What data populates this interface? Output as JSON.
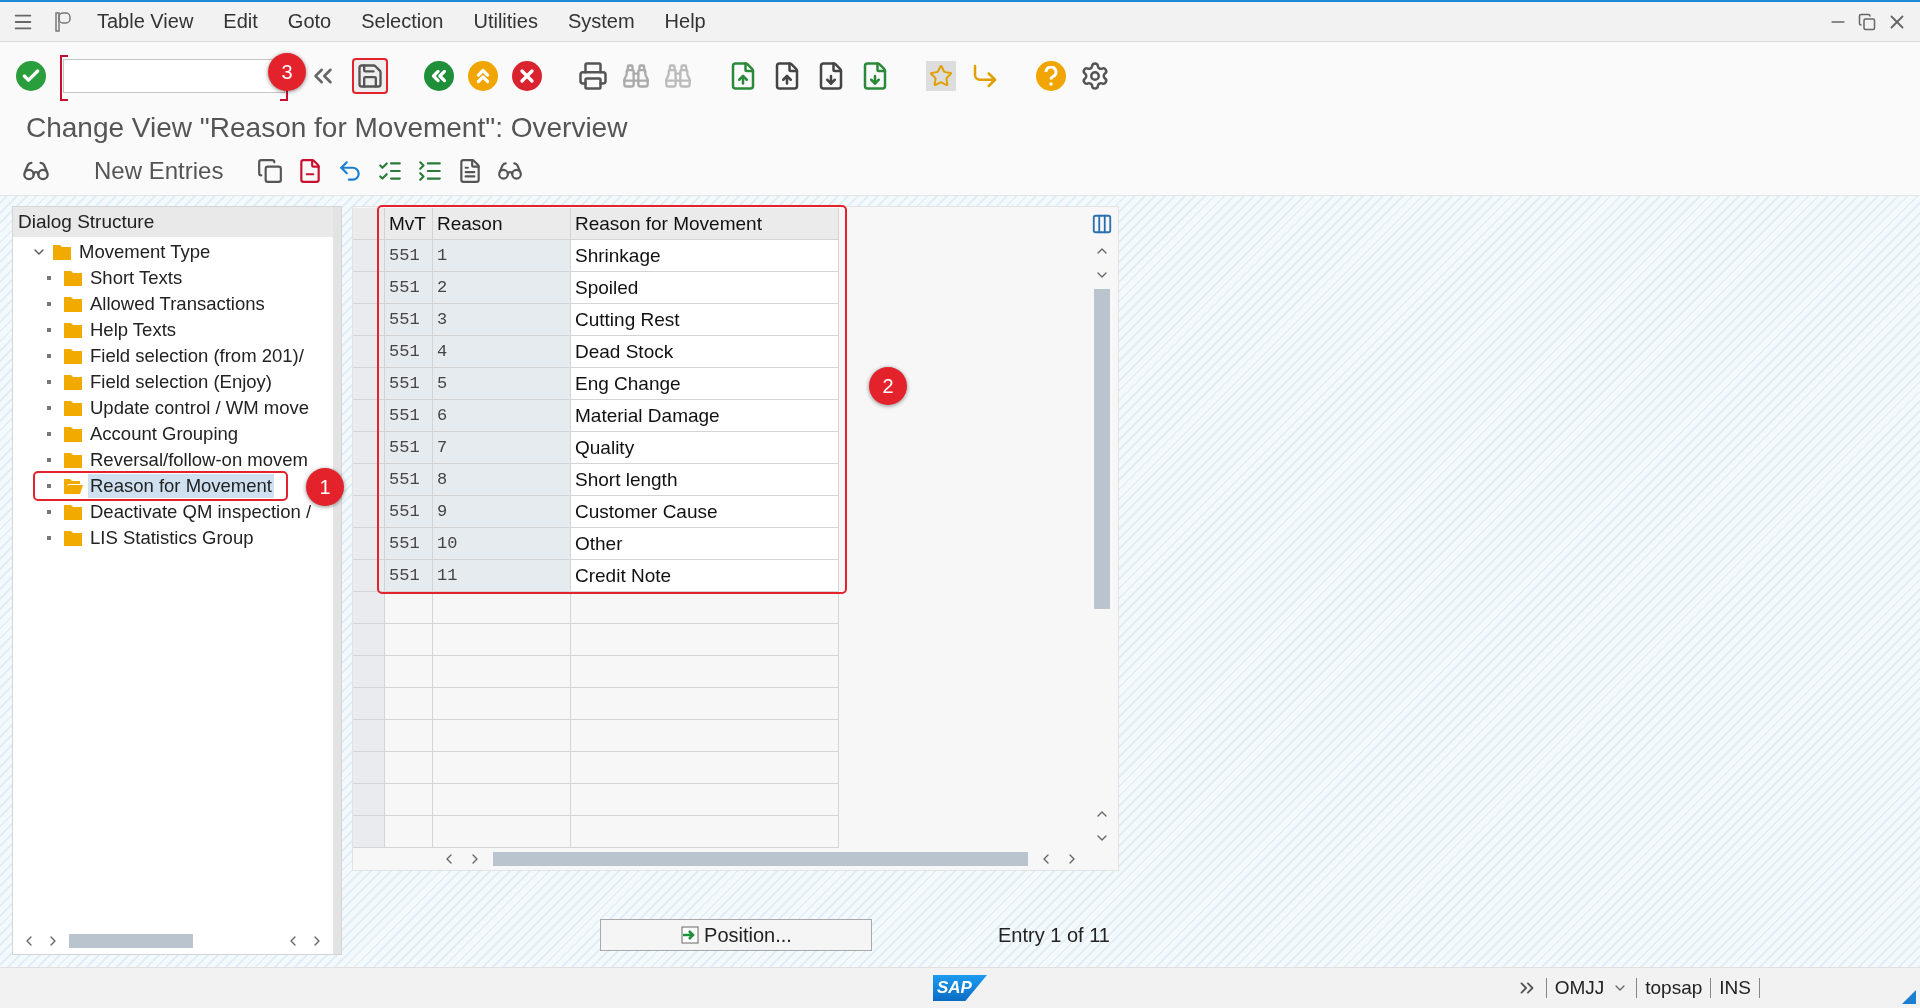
{
  "menu_bar": {
    "items": [
      "Table View",
      "Edit",
      "Goto",
      "Selection",
      "Utilities",
      "System",
      "Help"
    ]
  },
  "callouts": [
    {
      "kind": "toolbar",
      "label": "3"
    },
    {
      "kind": "tree",
      "label": "1"
    },
    {
      "kind": "table",
      "label": "2"
    }
  ],
  "title": "Change View \"Reason for Movement\": Overview",
  "app_toolbar": {
    "new_entries": "New Entries"
  },
  "dialog_structure": {
    "title": "Dialog Structure",
    "items": [
      {
        "label": "Movement Type",
        "expanded": true,
        "selected": false,
        "children": [
          {
            "label": "Short Texts",
            "selected": false
          },
          {
            "label": "Allowed Transactions",
            "selected": false
          },
          {
            "label": "Help Texts",
            "selected": false
          },
          {
            "label": "Field selection (from 201)/",
            "selected": false
          },
          {
            "label": "Field selection (Enjoy)",
            "selected": false
          },
          {
            "label": "Update control / WM move",
            "selected": false
          },
          {
            "label": "Account Grouping",
            "selected": false
          },
          {
            "label": "Reversal/follow-on movem",
            "selected": false
          },
          {
            "label": "Reason for Movement",
            "selected": true
          },
          {
            "label": "Deactivate QM inspection /",
            "selected": false
          },
          {
            "label": "LIS Statistics Group",
            "selected": false
          }
        ]
      }
    ]
  },
  "table": {
    "columns": [
      "MvT",
      "Reason",
      "Reason for Movement"
    ],
    "rows": [
      [
        "551",
        "1",
        "Shrinkage"
      ],
      [
        "551",
        "2",
        "Spoiled"
      ],
      [
        "551",
        "3",
        "Cutting Rest"
      ],
      [
        "551",
        "4",
        "Dead Stock"
      ],
      [
        "551",
        "5",
        "Eng Change"
      ],
      [
        "551",
        "6",
        "Material Damage"
      ],
      [
        "551",
        "7",
        "Quality"
      ],
      [
        "551",
        "8",
        "Short length"
      ],
      [
        "551",
        "9",
        "Customer Cause"
      ],
      [
        "551",
        "10",
        "Other"
      ],
      [
        "551",
        "11",
        "Credit Note"
      ]
    ]
  },
  "position_button": "Position...",
  "entry_info": "Entry 1 of 11",
  "status_bar": {
    "logo": "SAP",
    "transaction": "OMJJ",
    "system": "topsap",
    "mode": "INS"
  }
}
